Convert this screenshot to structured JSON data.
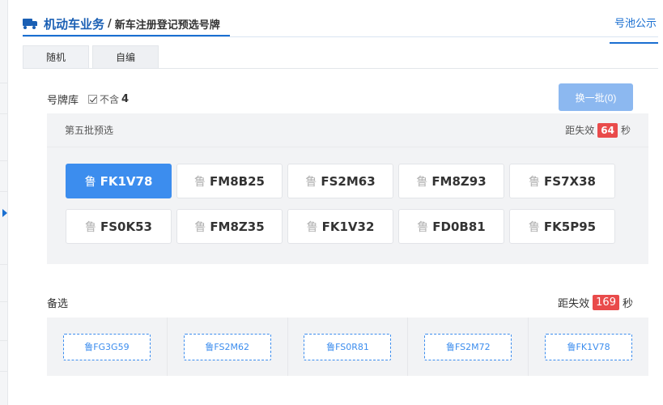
{
  "header": {
    "title_main": "机动车业务",
    "separator": "/",
    "title_sub": "新车注册登记预选号牌",
    "pool_link": "号池公示"
  },
  "tabs": [
    {
      "label": "随机",
      "active": true
    },
    {
      "label": "自编",
      "active": false
    }
  ],
  "library": {
    "label": "号牌库",
    "exclude_checked": true,
    "exclude_text": "不含",
    "exclude_digit": "4",
    "refresh_button": "换一批(0)"
  },
  "batch": {
    "title": "第五批预选",
    "countdown_prefix": "距失效",
    "countdown_value": "64",
    "countdown_suffix": "秒",
    "plates": [
      {
        "prov": "鲁",
        "number": "FK1V78",
        "selected": true
      },
      {
        "prov": "鲁",
        "number": "FM8B25",
        "selected": false
      },
      {
        "prov": "鲁",
        "number": "FS2M63",
        "selected": false
      },
      {
        "prov": "鲁",
        "number": "FM8Z93",
        "selected": false
      },
      {
        "prov": "鲁",
        "number": "FS7X38",
        "selected": false
      },
      {
        "prov": "鲁",
        "number": "FS0K53",
        "selected": false
      },
      {
        "prov": "鲁",
        "number": "FM8Z35",
        "selected": false
      },
      {
        "prov": "鲁",
        "number": "FK1V32",
        "selected": false
      },
      {
        "prov": "鲁",
        "number": "FD0B81",
        "selected": false
      },
      {
        "prov": "鲁",
        "number": "FK5P95",
        "selected": false
      }
    ]
  },
  "backup": {
    "label": "备选",
    "countdown_prefix": "距失效",
    "countdown_value": "169",
    "countdown_suffix": "秒",
    "plates": [
      {
        "text": "鲁FG3G59"
      },
      {
        "text": "鲁FS2M62"
      },
      {
        "text": "鲁FS0R81"
      },
      {
        "text": "鲁FS2M72"
      },
      {
        "text": "鲁FK1V78"
      }
    ]
  },
  "colors": {
    "brand_blue": "#1a5fb4",
    "selected_plate": "#3c8dee",
    "badge_red": "#e94b4b",
    "refresh_button": "#8cb8f0"
  }
}
